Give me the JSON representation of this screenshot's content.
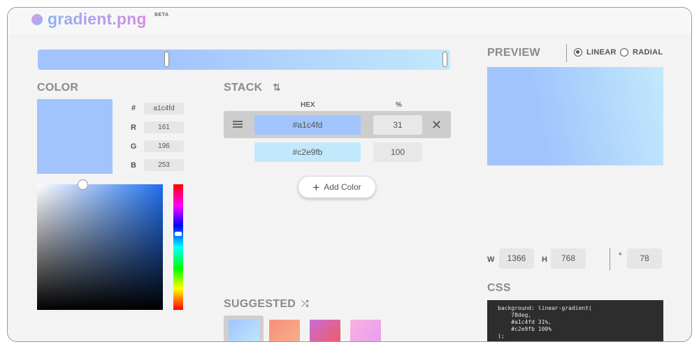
{
  "app": {
    "title": "gradient.png",
    "badge": "BETA"
  },
  "gradient": {
    "type": "linear",
    "angle": 78,
    "stops": [
      {
        "hex": "#a1c4fd",
        "pct": 31
      },
      {
        "hex": "#c2e9fb",
        "pct": 100
      }
    ]
  },
  "color": {
    "title": "COLOR",
    "hex_label": "#",
    "hex": "a1c4fd",
    "r_label": "R",
    "r": "161",
    "g_label": "G",
    "g": "196",
    "b_label": "B",
    "b": "253",
    "swatch": "#a1c4fd"
  },
  "stack": {
    "title": "STACK",
    "col_hex": "HEX",
    "col_pct": "%",
    "rows": [
      {
        "hex": "#a1c4fd",
        "pct": "31",
        "color": "#a1c4fd"
      },
      {
        "hex": "#c2e9fb",
        "pct": "100",
        "color": "#c2e9fb"
      }
    ],
    "add_label": "Add Color"
  },
  "suggested": {
    "title": "SUGGESTED",
    "gradients": [
      [
        "#a1c4fd",
        "#c2e9fb"
      ],
      [
        "#f78f7b",
        "#f4b38c"
      ],
      [
        "#c86dd7",
        "#f25a5a"
      ],
      [
        "#f9b2de",
        "#e49df2"
      ]
    ]
  },
  "preview": {
    "title": "PREVIEW",
    "linear_label": "LINEAR",
    "radial_label": "RADIAL",
    "selected": "linear"
  },
  "dimensions": {
    "w_label": "W",
    "w": "1366",
    "h_label": "H",
    "h": "768",
    "angle_label": "°",
    "angle": "78"
  },
  "css": {
    "title": "CSS",
    "code": "background: linear-gradient(\n    78deg,\n    #a1c4fd 31%,\n    #c2e9fb 100%\n);"
  }
}
